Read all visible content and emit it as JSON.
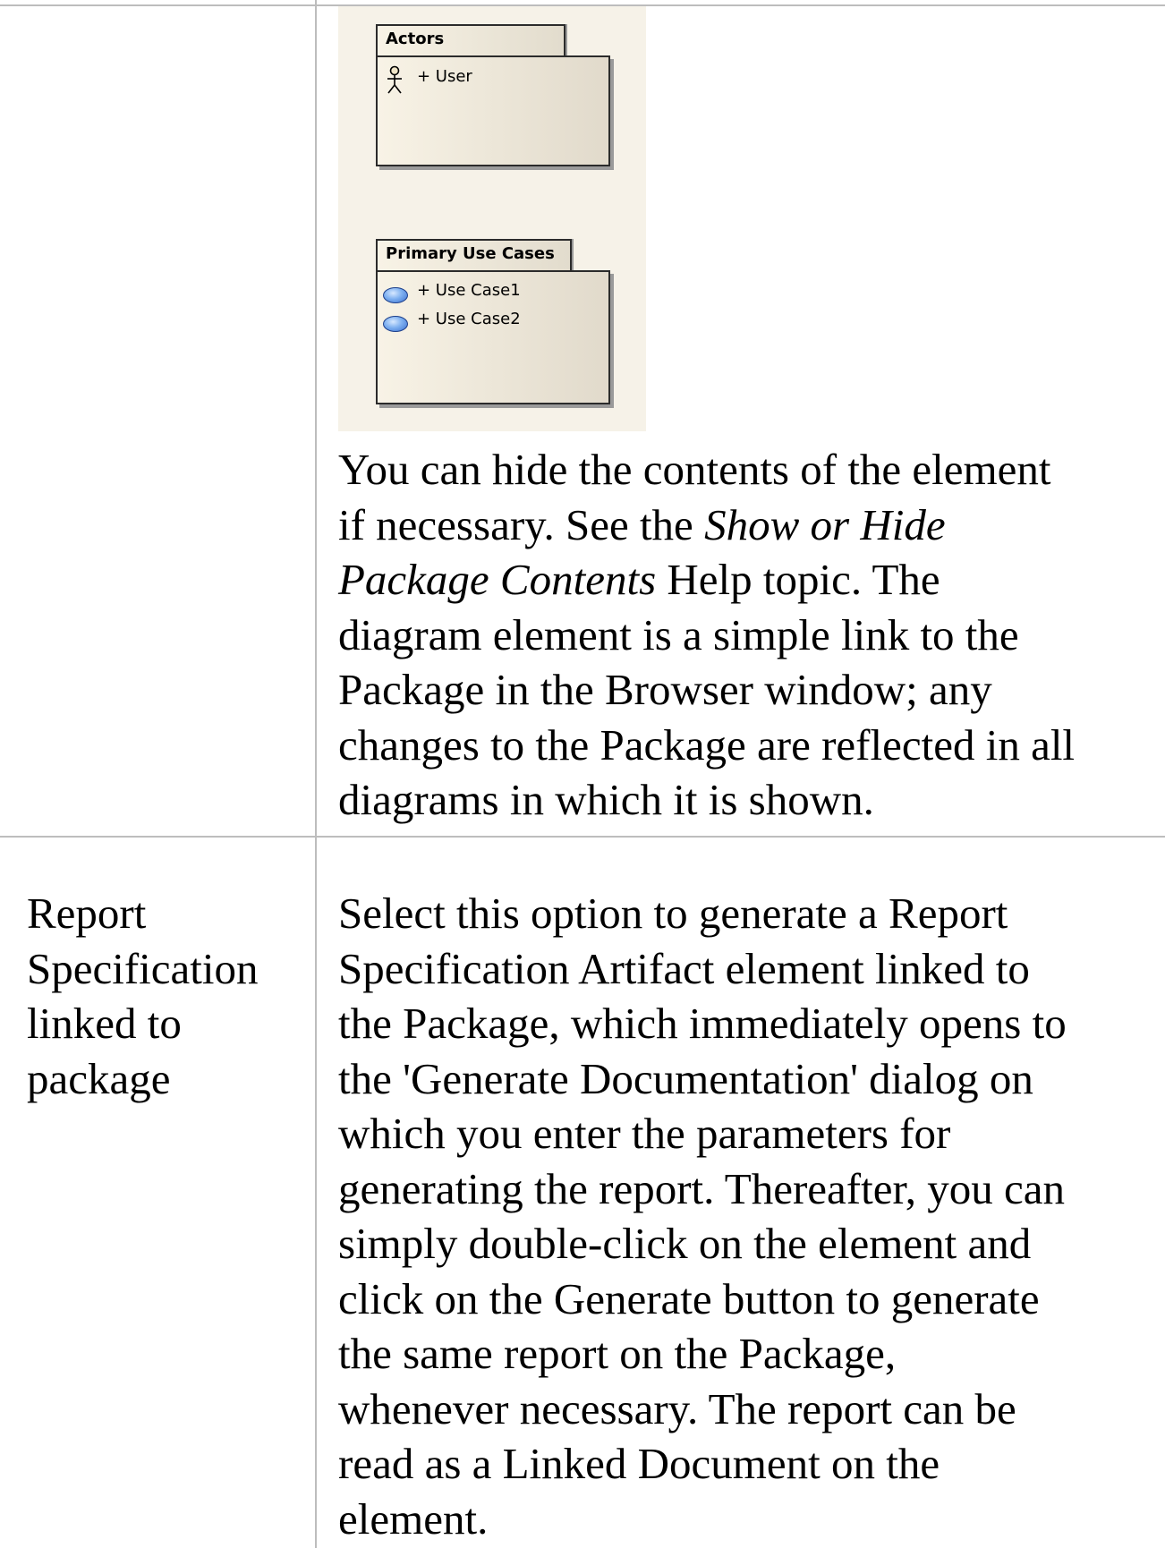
{
  "row1": {
    "label": "",
    "diagram": {
      "packages": [
        {
          "name": "Actors",
          "items": [
            {
              "icon": "actor-icon",
              "label": "+ User"
            }
          ]
        },
        {
          "name": "Primary Use Cases",
          "items": [
            {
              "icon": "use-case-icon",
              "label": "+ Use Case1"
            },
            {
              "icon": "use-case-icon",
              "label": "+ Use Case2"
            }
          ]
        }
      ]
    },
    "description": {
      "l1": "You can hide the contents of the element",
      "l2_a": "if necessary. See the ",
      "l2_b": "Show or Hide",
      "l3_a": "Package Contents",
      "l3_b": " Help topic. The",
      "l4": "diagram element is a simple link to the",
      "l5": "Package in the Browser window; any",
      "l6": "changes to the Package are reflected in all",
      "l7": "diagrams in which it is shown."
    }
  },
  "row2": {
    "label": {
      "l1": "Report",
      "l2": "Specification",
      "l3": "linked to",
      "l4": "package"
    },
    "description": {
      "l1": "Select this option to generate a Report",
      "l2": "Specification Artifact element linked to",
      "l3": "the Package, which immediately opens to",
      "l4": "the 'Generate Documentation' dialog on",
      "l5": "which you enter the parameters for",
      "l6": "generating the report. Thereafter, you can",
      "l7": "simply double-click on the element and",
      "l8": "click on the Generate button to generate",
      "l9": "the same report on the Package,",
      "l10": "whenever necessary. The report can be",
      "l11": "read as a Linked Document on the",
      "l12": "element."
    }
  }
}
